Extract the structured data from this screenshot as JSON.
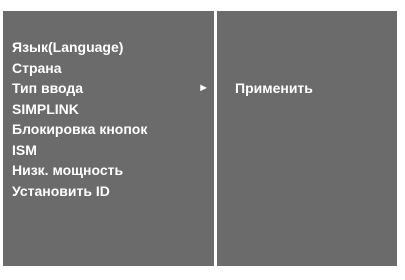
{
  "menu": {
    "items": [
      {
        "label": "Язык(Language)"
      },
      {
        "label": "Страна"
      },
      {
        "label": "Тип ввода",
        "arrow": "►"
      },
      {
        "label": "SIMPLINK"
      },
      {
        "label": "Блокировка кнопок"
      },
      {
        "label": "ISM"
      },
      {
        "label": "Низк. мощность"
      },
      {
        "label": "Установить ID"
      }
    ]
  },
  "submenu": {
    "items": [
      {
        "label": "Применить"
      }
    ]
  },
  "colors": {
    "panel": "#6b6b6b",
    "border": "#ffffff",
    "text": "#ffffff"
  }
}
